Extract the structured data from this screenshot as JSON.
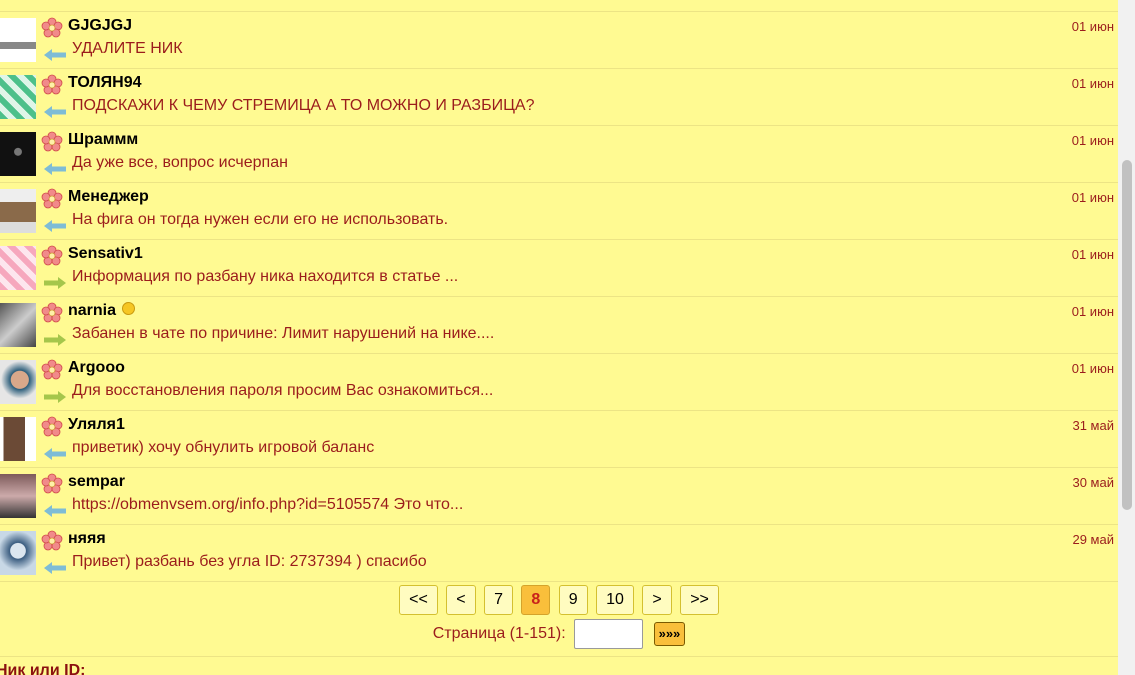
{
  "messages": [
    {
      "nick": "GJGJGJ",
      "date": "01 июн",
      "text": "УДАЛИТЕ НИК",
      "dir": "in",
      "medal": false
    },
    {
      "nick": "ТОЛЯН94",
      "date": "01 июн",
      "text": "ПОДСКАЖИ К ЧЕМУ СТРЕМИЦА А ТО МОЖНО И РАЗБИЦА?",
      "dir": "in",
      "medal": false
    },
    {
      "nick": "Шраммм",
      "date": "01 июн",
      "text": "Да уже все, вопрос исчерпан",
      "dir": "in",
      "medal": false
    },
    {
      "nick": "Менеджер",
      "date": "01 июн",
      "text": "На фига он тогда нужен если его не использовать.",
      "dir": "in",
      "medal": false
    },
    {
      "nick": "Sensativ1",
      "date": "01 июн",
      "text": "Информация по разбану ника находится в статье ...",
      "dir": "out",
      "medal": false
    },
    {
      "nick": "narnia",
      "date": "01 июн",
      "text": "Забанен в чате по причине: Лимит нарушений на нике....",
      "dir": "out",
      "medal": true
    },
    {
      "nick": "Argooo",
      "date": "01 июн",
      "text": "Для восстановления пароля просим Вас ознакомиться...",
      "dir": "out",
      "medal": false
    },
    {
      "nick": "Уляля1",
      "date": "31 май",
      "text": "приветик) хочу обнулить игровой баланс",
      "dir": "in",
      "medal": false
    },
    {
      "nick": "sempar",
      "date": "30 май",
      "text": "https://obmenvsem.org/info.php?id=5105574 Это что...",
      "dir": "in",
      "medal": false
    },
    {
      "nick": "няяя",
      "date": "29 май",
      "text": "Привет) разбань без угла ID: 2737394 ) спасибо",
      "dir": "in",
      "medal": false
    }
  ],
  "pagination": {
    "first": "<<",
    "prev": "<",
    "pages": [
      "7",
      "8",
      "9",
      "10"
    ],
    "current": "8",
    "next": ">",
    "last": ">>",
    "page_label": "Страница (1-151):",
    "go_label": "»»»"
  },
  "nick_label": "Ник или ID:",
  "colors": {
    "background": "#fffa92",
    "message_text": "#9b1c1c",
    "active_page": "#f9bf3b",
    "arrow_in": "#7ebcd6",
    "arrow_out": "#a5c64b"
  }
}
